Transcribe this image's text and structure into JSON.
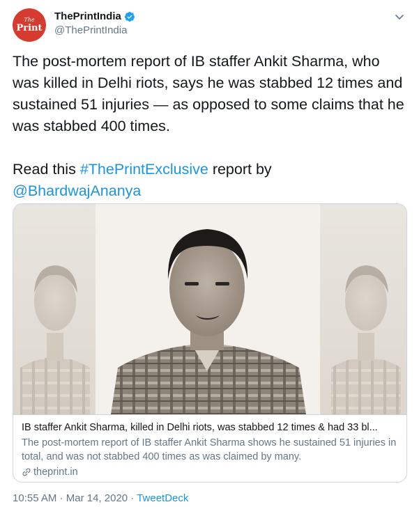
{
  "account": {
    "display_name": "ThePrintIndia",
    "handle": "@ThePrintIndia",
    "avatar_text_top": "The",
    "avatar_text_main": "Print",
    "avatar_color": "#d63b2f"
  },
  "tweet": {
    "paragraph1": "The post-mortem report of IB staffer Ankit Sharma, who was killed in Delhi riots, says he was stabbed 12 times and sustained 51 injuries — as opposed to some claims that he was stabbed 400 times.",
    "read_prefix": "Read this ",
    "hashtag": "#ThePrintExclusive",
    "read_suffix": " report by",
    "mention": "@BhardwajAnanya"
  },
  "card": {
    "title": "IB staffer Ankit Sharma, killed in Delhi riots, was stabbed 12 times & had 33 bl...",
    "description": "The post-mortem report of IB staffer Ankit Sharma shows he sustained 51 injuries in total, and was not stabbed 400 times as was claimed by many.",
    "domain": "theprint.in"
  },
  "footer": {
    "time": "10:55 AM",
    "separator1": " · ",
    "date": "Mar 14, 2020",
    "separator2": " · ",
    "source": "TweetDeck"
  },
  "colors": {
    "link_blue": "#1b95e0",
    "secondary_text": "#657786",
    "border": "#ccd6dd"
  }
}
